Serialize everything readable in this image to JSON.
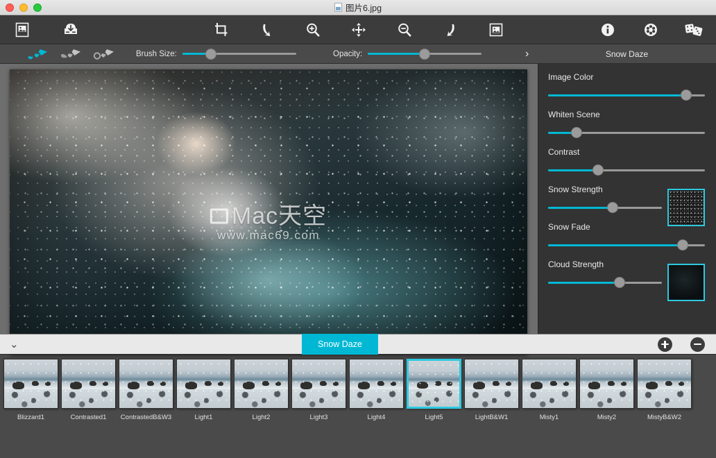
{
  "window": {
    "title": "图片6.jpg",
    "traffic_lights": [
      "close",
      "minimize",
      "maximize"
    ]
  },
  "toolbar": {
    "left": [
      {
        "name": "open-image",
        "icon": "image-frame-icon"
      },
      {
        "name": "save-image",
        "icon": "save-download-icon"
      }
    ],
    "center": [
      {
        "name": "crop",
        "icon": "crop-icon"
      },
      {
        "name": "undo",
        "icon": "undo-arrow-icon"
      },
      {
        "name": "zoom-in",
        "icon": "magnifier-plus-icon"
      },
      {
        "name": "pan",
        "icon": "move-arrows-icon"
      },
      {
        "name": "zoom-out",
        "icon": "magnifier-minus-icon"
      },
      {
        "name": "redo",
        "icon": "redo-arrow-icon"
      },
      {
        "name": "fit-to-screen",
        "icon": "image-fit-icon"
      }
    ],
    "right": [
      {
        "name": "info",
        "icon": "info-circle-icon"
      },
      {
        "name": "settings",
        "icon": "gear-flower-icon"
      },
      {
        "name": "randomize",
        "icon": "dice-icon"
      }
    ]
  },
  "options_bar": {
    "brushes": [
      {
        "name": "brush-paint",
        "active": true
      },
      {
        "name": "brush-erase",
        "active": false
      },
      {
        "name": "brush-smudge",
        "active": false
      }
    ],
    "brush_size_label": "Brush Size:",
    "brush_size_value": 25,
    "opacity_label": "Opacity:",
    "opacity_value": 50,
    "next_chevron": "›",
    "effect_title": "Snow Daze"
  },
  "canvas": {
    "watermark_brand": "Mac天空",
    "watermark_url": "www.mac69.com"
  },
  "controls": [
    {
      "name": "image-color",
      "label": "Image Color",
      "value": 88,
      "swatch": null
    },
    {
      "name": "whiten-scene",
      "label": "Whiten Scene",
      "value": 18,
      "swatch": null
    },
    {
      "name": "contrast",
      "label": "Contrast",
      "value": 32,
      "swatch": null
    },
    {
      "name": "snow-strength",
      "label": "Snow Strength",
      "value": 57,
      "swatch": "snow"
    },
    {
      "name": "snow-fade",
      "label": "Snow Fade",
      "value": 86,
      "swatch": null
    },
    {
      "name": "cloud-strength",
      "label": "Cloud Strength",
      "value": 63,
      "swatch": "cloud"
    }
  ],
  "preset_bar": {
    "collapse_chevron": "⌄",
    "active_tab": "Snow Daze",
    "add_button": "add-preset",
    "remove_button": "remove-preset"
  },
  "presets": [
    {
      "label": "Blizzard1",
      "selected": false
    },
    {
      "label": "Contrasted1",
      "selected": false
    },
    {
      "label": "ContrastedB&W3",
      "selected": false
    },
    {
      "label": "Light1",
      "selected": false
    },
    {
      "label": "Light2",
      "selected": false
    },
    {
      "label": "Light3",
      "selected": false
    },
    {
      "label": "Light4",
      "selected": false
    },
    {
      "label": "Light5",
      "selected": true
    },
    {
      "label": "LightB&W1",
      "selected": false
    },
    {
      "label": "Misty1",
      "selected": false
    },
    {
      "label": "Misty2",
      "selected": false
    },
    {
      "label": "MistyB&W2",
      "selected": false
    }
  ],
  "colors": {
    "accent": "#00b8d4",
    "swatch_border": "#2ec9e0",
    "toolbar_bg": "#3c3c3c",
    "panel_bg": "#333333",
    "canvas_bg": "#6e6e6e"
  }
}
